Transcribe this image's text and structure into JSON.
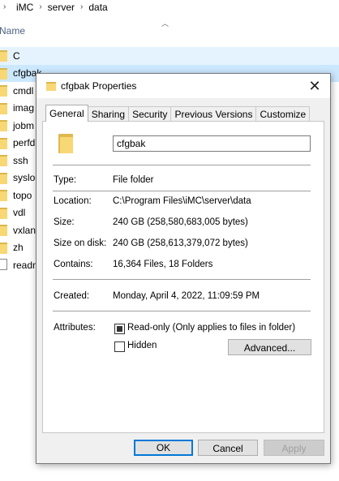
{
  "explorer": {
    "breadcrumb": [
      "iMC",
      "server",
      "data"
    ],
    "column_name": "Name",
    "items": [
      {
        "name": "C",
        "type": "folder",
        "state": "hover"
      },
      {
        "name": "cfgbak",
        "type": "folder",
        "state": "selected"
      },
      {
        "name": "cmdl",
        "type": "folder",
        "state": ""
      },
      {
        "name": "imag",
        "type": "folder",
        "state": ""
      },
      {
        "name": "jobm",
        "type": "folder",
        "state": ""
      },
      {
        "name": "perfd",
        "type": "folder",
        "state": ""
      },
      {
        "name": "ssh",
        "type": "folder",
        "state": ""
      },
      {
        "name": "syslog",
        "type": "folder",
        "state": ""
      },
      {
        "name": "topo",
        "type": "folder",
        "state": ""
      },
      {
        "name": "vdl",
        "type": "folder",
        "state": ""
      },
      {
        "name": "vxlan",
        "type": "folder",
        "state": ""
      },
      {
        "name": "zh",
        "type": "folder",
        "state": ""
      },
      {
        "name": "readn",
        "type": "file",
        "state": ""
      }
    ]
  },
  "dialog": {
    "title": "cfgbak Properties",
    "tabs": [
      "General",
      "Sharing",
      "Security",
      "Previous Versions",
      "Customize"
    ],
    "active_tab": "General",
    "name_value": "cfgbak",
    "props": {
      "type_label": "Type:",
      "type_value": "File folder",
      "location_label": "Location:",
      "location_value": "C:\\Program Files\\iMC\\server\\data",
      "size_label": "Size:",
      "size_value": "240 GB (258,580,683,005 bytes)",
      "size_on_disk_label": "Size on disk:",
      "size_on_disk_value": "240 GB (258,613,379,072 bytes)",
      "contains_label": "Contains:",
      "contains_value": "16,364 Files, 18 Folders",
      "created_label": "Created:",
      "created_value": "Monday, April 4, 2022, 11:09:59 PM",
      "attributes_label": "Attributes:",
      "readonly_label": "Read-only (Only applies to files in folder)",
      "readonly_state": "indeterminate",
      "hidden_label": "Hidden",
      "hidden_state": "unchecked"
    },
    "buttons": {
      "advanced": "Advanced...",
      "ok": "OK",
      "cancel": "Cancel",
      "apply": "Apply"
    }
  },
  "colors": {
    "selection": "#cce8ff",
    "hover": "#e5f3ff",
    "folder": "#f8d775",
    "accent": "#0078d7"
  }
}
